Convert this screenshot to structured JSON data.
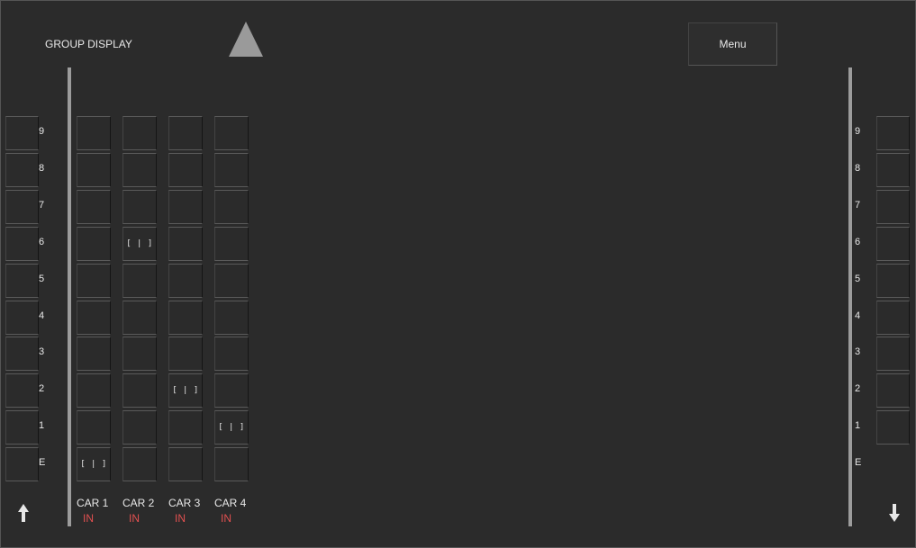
{
  "header": {
    "title": "GROUP DISPLAY",
    "menu_label": "Menu",
    "scroll_up_icon": "triangle-up-icon"
  },
  "floors": [
    "9",
    "8",
    "7",
    "6",
    "5",
    "4",
    "3",
    "2",
    "1",
    "E"
  ],
  "left_call_buttons": [
    "9",
    "8",
    "7",
    "6",
    "5",
    "4",
    "3",
    "2",
    "1",
    "E"
  ],
  "right_call_buttons": [
    "9",
    "8",
    "7",
    "6",
    "5",
    "4",
    "3",
    "2",
    "1"
  ],
  "cars": [
    {
      "name": "CAR 1",
      "status": "IN",
      "floor": "E"
    },
    {
      "name": "CAR 2",
      "status": "IN",
      "floor": "6"
    },
    {
      "name": "CAR 3",
      "status": "IN",
      "floor": "2"
    },
    {
      "name": "CAR 4",
      "status": "IN",
      "floor": "1"
    }
  ],
  "car_indicator_glyph": "[ | ]",
  "arrows": {
    "left": "up-arrow-icon",
    "right": "down-arrow-icon"
  },
  "colors": {
    "background": "#2b2b2b",
    "status_in": "#e05050",
    "rail": "#9c9c9c"
  }
}
